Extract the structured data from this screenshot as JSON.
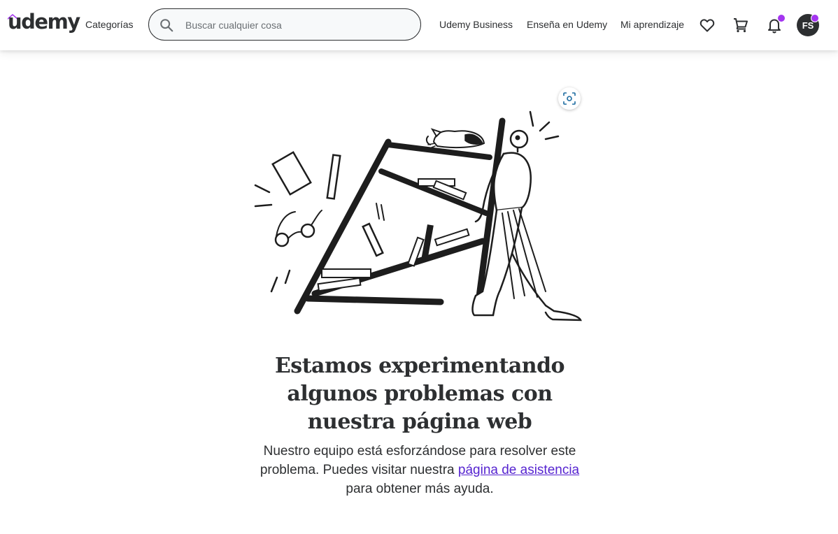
{
  "header": {
    "logo_text": "udemy",
    "categories_label": "Categorías",
    "search": {
      "placeholder": "Buscar cualquier cosa",
      "value": ""
    },
    "links": {
      "business": "Udemy Business",
      "teach": "Enseña en Udemy",
      "my_learning": "Mi aprendizaje"
    },
    "icons": [
      "heart-icon",
      "cart-icon",
      "bell-icon"
    ],
    "notification_dot_color": "#a435f0",
    "avatar_initials": "FS"
  },
  "main": {
    "title_lines": [
      "Estamos experimentando",
      "algunos problemas con",
      "nuestra página web"
    ],
    "body_line1": "Nuestro equipo está esforzándose para resolver este",
    "body_line2_prefix": "problema. Puedes visitar nuestra ",
    "support_link": "página de asistencia",
    "body_line3": "para obtener más ayuda.",
    "link_color": "#5624d0"
  }
}
